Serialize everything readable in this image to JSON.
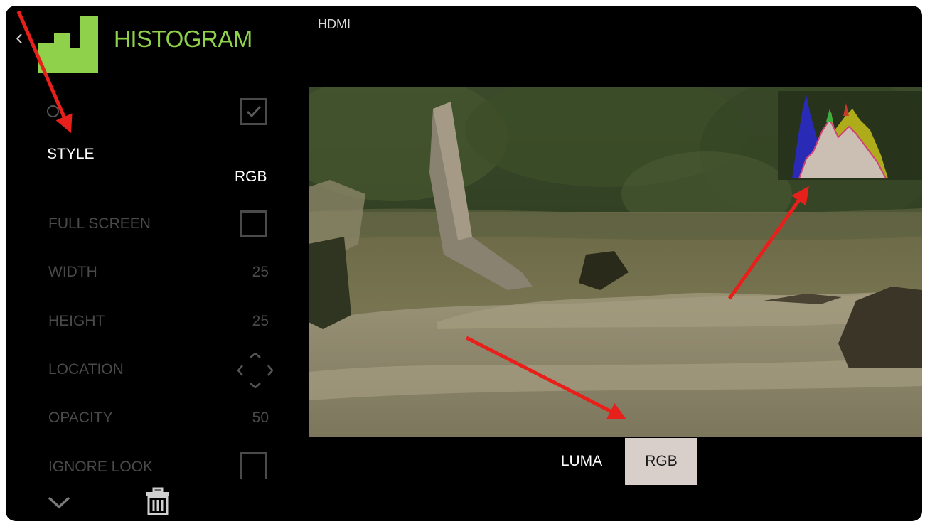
{
  "header": {
    "app_title": "HISTOGRAM",
    "source_label": "HDMI",
    "back_icon": "chevron-left-icon",
    "logo_icon": "histogram-logo-icon",
    "title_color": "#8fd14a"
  },
  "settings": {
    "enabled": {
      "checked": true
    },
    "style": {
      "label": "STYLE",
      "value": "RGB"
    },
    "full_screen": {
      "label": "FULL SCREEN",
      "checked": false
    },
    "width": {
      "label": "WIDTH",
      "value": "25"
    },
    "height": {
      "label": "HEIGHT",
      "value": "25"
    },
    "location": {
      "label": "LOCATION",
      "icon": "location-diamond-icon"
    },
    "opacity": {
      "label": "OPACITY",
      "value": "50"
    },
    "ignore_look": {
      "label": "IGNORE LOOK",
      "checked": false
    }
  },
  "footer": {
    "scroll_icon": "chevron-down-icon",
    "delete_icon": "trash-icon"
  },
  "style_tabs": [
    {
      "label": "LUMA",
      "selected": false
    },
    {
      "label": "RGB",
      "selected": true
    }
  ],
  "annotations": {
    "arrow_color": "#e8201c",
    "count": 3
  }
}
